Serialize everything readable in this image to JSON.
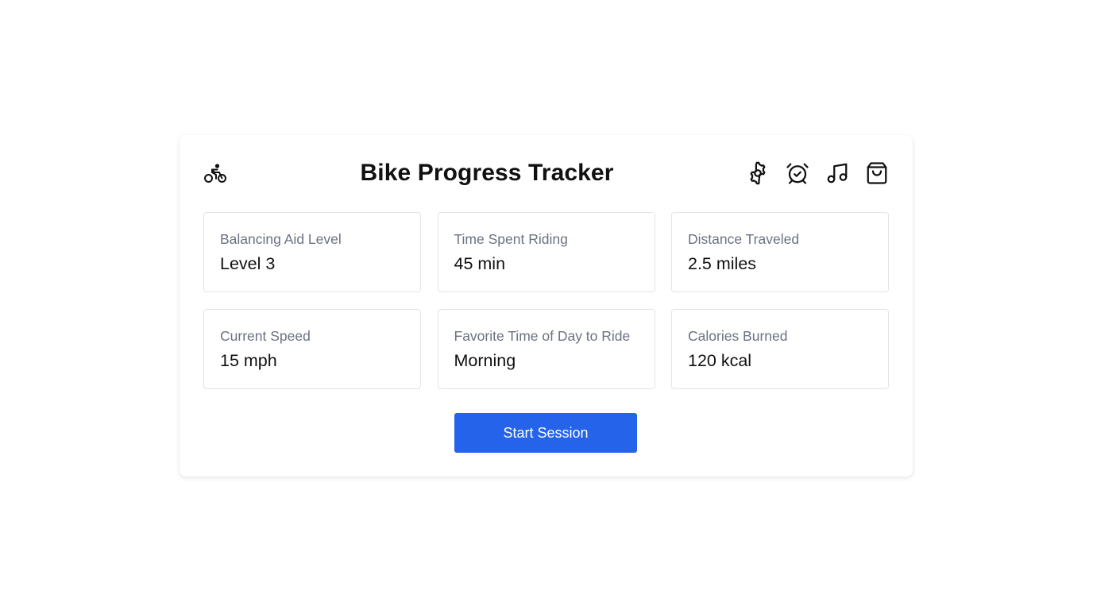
{
  "header": {
    "logo_icon": "bicycle-icon",
    "title": "Bike Progress Tracker",
    "actions": [
      {
        "icon": "gear-icon"
      },
      {
        "icon": "alarm-clock-check-icon"
      },
      {
        "icon": "music-note-icon"
      },
      {
        "icon": "shopping-bag-icon"
      }
    ]
  },
  "stats": [
    {
      "label": "Balancing Aid Level",
      "value": "Level 3"
    },
    {
      "label": "Time Spent Riding",
      "value": "45 min"
    },
    {
      "label": "Distance Traveled",
      "value": "2.5 miles"
    },
    {
      "label": "Current Speed",
      "value": "15 mph"
    },
    {
      "label": "Favorite Time of Day to Ride",
      "value": "Morning"
    },
    {
      "label": "Calories Burned",
      "value": "120 kcal"
    }
  ],
  "start_button": {
    "label": "Start Session"
  },
  "colors": {
    "accent": "#2563eb",
    "label_text": "#6b7280",
    "value_text": "#111111",
    "border": "#e2e4e8"
  }
}
